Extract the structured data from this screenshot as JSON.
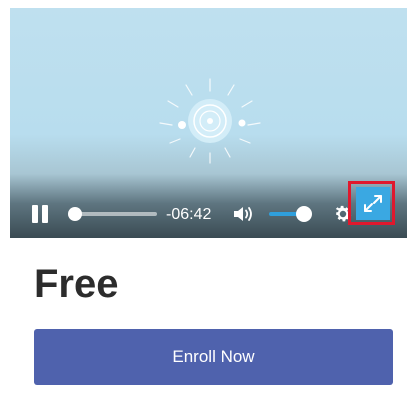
{
  "player": {
    "time_remaining": "-06:42",
    "progress_fraction": 0.0,
    "volume_fraction": 0.85,
    "icons": {
      "pause": "pause-icon",
      "volume": "volume-icon",
      "settings": "gear-icon",
      "fullscreen": "fullscreen-icon"
    },
    "colors": {
      "accent": "#2f9fdc",
      "fullscreen_bg": "#3aa8e2",
      "highlight_border": "#e0182d"
    }
  },
  "course": {
    "price": "Free",
    "enroll_label": "Enroll Now",
    "button_color": "#4f62ad"
  }
}
